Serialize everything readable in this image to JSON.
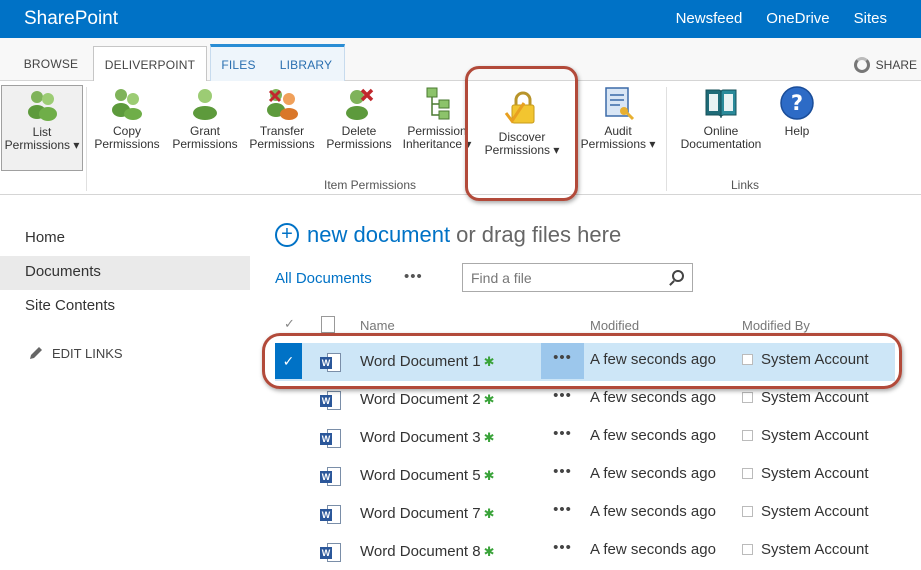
{
  "suite": {
    "brand": "SharePoint",
    "links": [
      "Newsfeed",
      "OneDrive",
      "Sites"
    ]
  },
  "tabs": {
    "browse": "BROWSE",
    "deliverpoint": "DELIVERPOINT",
    "files": "FILES",
    "library": "LIBRARY",
    "share": "SHARE"
  },
  "ribbon": {
    "buttons": [
      {
        "line1": "List",
        "line2": "Permissions ▾"
      },
      {
        "line1": "Copy",
        "line2": "Permissions"
      },
      {
        "line1": "Grant",
        "line2": "Permissions"
      },
      {
        "line1": "Transfer",
        "line2": "Permissions"
      },
      {
        "line1": "Delete",
        "line2": "Permissions"
      },
      {
        "line1": "Permission",
        "line2": "Inheritance ▾"
      },
      {
        "line1": "Discover",
        "line2": "Permissions ▾"
      },
      {
        "line1": "Audit",
        "line2": "Permissions ▾"
      },
      {
        "line1": "Online",
        "line2": "Documentation"
      },
      {
        "line1": "Help",
        "line2": ""
      }
    ],
    "group_item_permissions": "Item Permissions",
    "group_links": "Links"
  },
  "nav": {
    "items": [
      "Home",
      "Documents",
      "Site Contents"
    ],
    "edit_links": "EDIT LINKS"
  },
  "main": {
    "new_document": "new document",
    "drag_text": "or drag files here",
    "view": "All Documents",
    "view_more": "•••",
    "search_placeholder": "Find a file",
    "columns": {
      "check": "✓",
      "name": "Name",
      "modified": "Modified",
      "modified_by": "Modified By"
    }
  },
  "rows": [
    {
      "name": "Word Document 1",
      "modified": "A few seconds ago",
      "modified_by": "System Account"
    },
    {
      "name": "Word Document 2",
      "modified": "A few seconds ago",
      "modified_by": "System Account"
    },
    {
      "name": "Word Document 3",
      "modified": "A few seconds ago",
      "modified_by": "System Account"
    },
    {
      "name": "Word Document 5",
      "modified": "A few seconds ago",
      "modified_by": "System Account"
    },
    {
      "name": "Word Document 7",
      "modified": "A few seconds ago",
      "modified_by": "System Account"
    },
    {
      "name": "Word Document 8",
      "modified": "A few seconds ago",
      "modified_by": "System Account"
    }
  ],
  "colors": {
    "suite_blue": "#0072c6",
    "highlight_red": "#b24a3a",
    "selected_row": "#cde6f7"
  }
}
